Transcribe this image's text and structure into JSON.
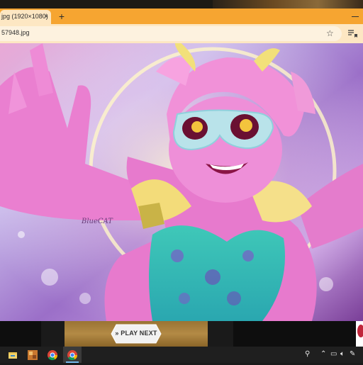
{
  "browser": {
    "tab_title": "jpg (1920×1080)",
    "tab_close": "×",
    "new_tab": "+",
    "url": "57948.jpg",
    "bookmark_icon": "star-icon",
    "queue_icon": "reading-queue-icon",
    "accent_color": "#f6a531",
    "toolbar_color": "#fde7c3"
  },
  "image": {
    "signature": "BlueCAT"
  },
  "ad": {
    "play_label": "PLAY NEXT",
    "play_icon": "double-chevron-icon"
  },
  "taskbar": {
    "apps": [
      "file-explorer-icon",
      "photos-icon",
      "chrome-icon",
      "chrome-active-icon"
    ],
    "tray": [
      "people-icon",
      "chevron-up-icon",
      "network-icon",
      "volume-icon",
      "language-icon",
      "pen-icon"
    ]
  }
}
